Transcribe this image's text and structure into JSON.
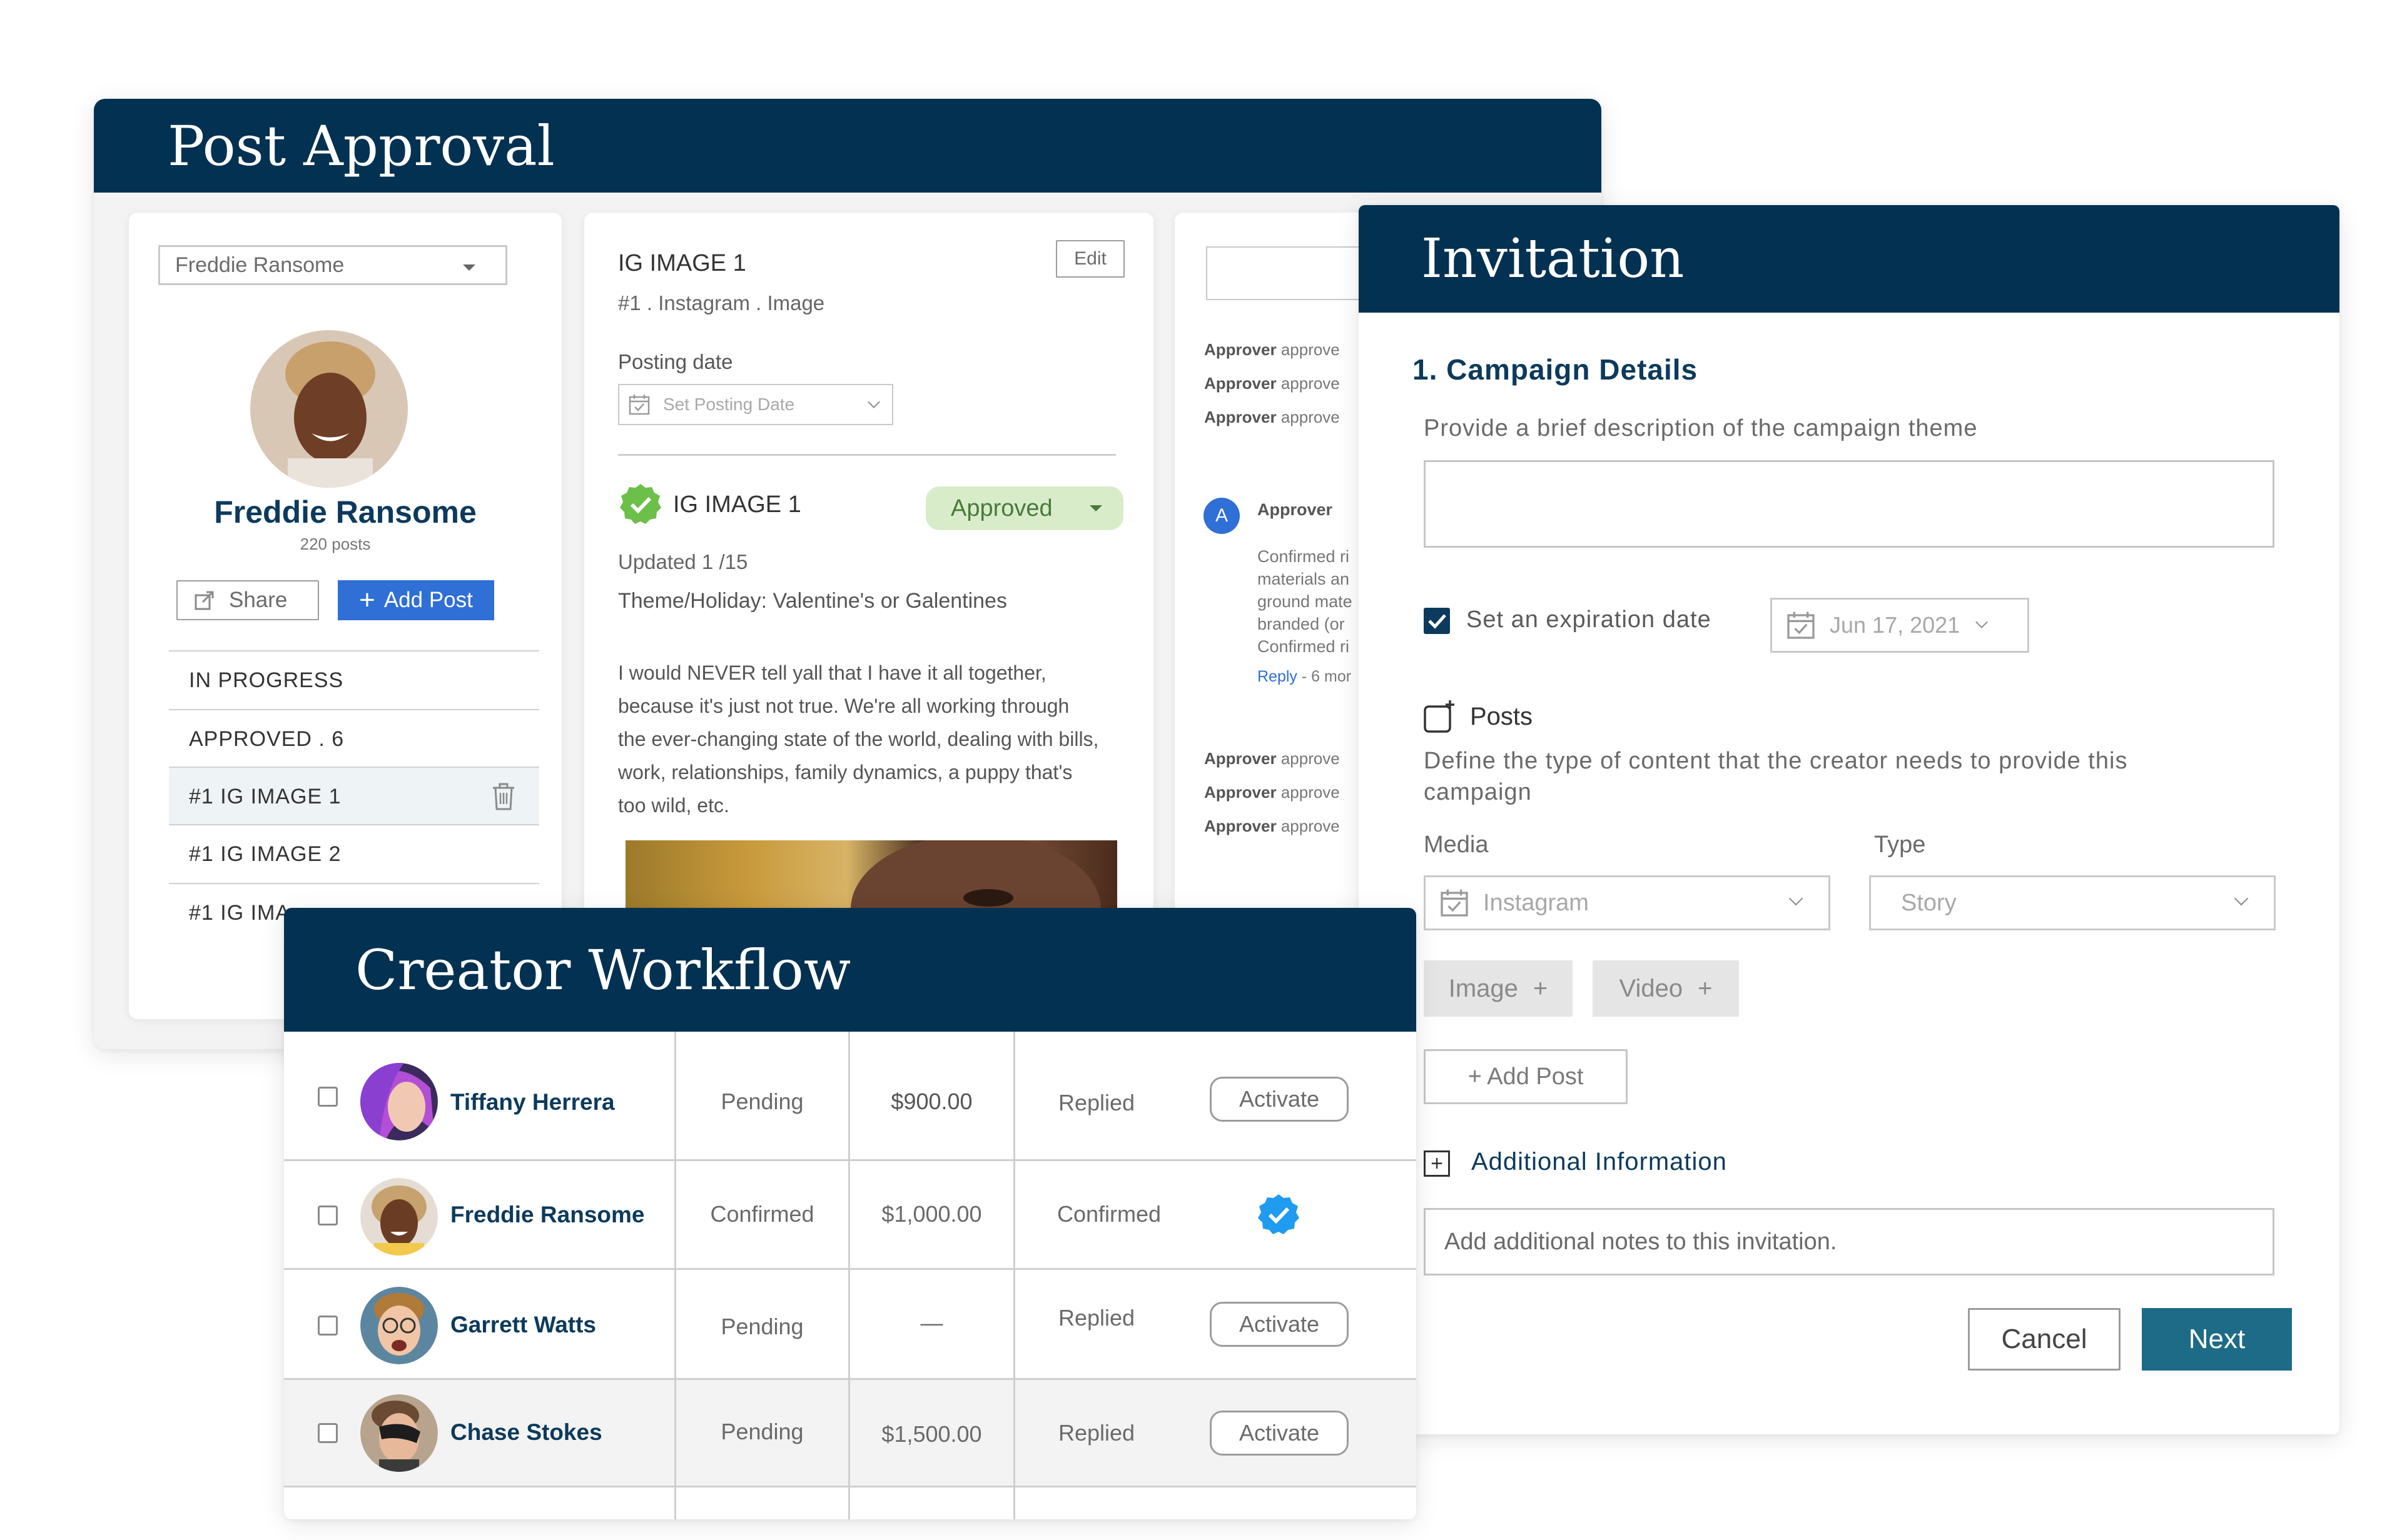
{
  "post_approval": {
    "title": "Post Approval",
    "creator_select": "Freddie Ransome",
    "profile": {
      "name": "Freddie Ransome",
      "posts": "220 posts"
    },
    "share_label": "Share",
    "add_post_label": "Add Post",
    "sections": [
      {
        "label": "IN PROGRESS"
      },
      {
        "label": "APPROVED . 6"
      },
      {
        "label": "#1 IG IMAGE 1"
      },
      {
        "label": "#1 IG IMAGE 2"
      },
      {
        "label": "#1 IG IMA"
      }
    ],
    "detail": {
      "title": "IG IMAGE 1",
      "subtitle": "#1 . Instagram . Image",
      "edit_label": "Edit",
      "posting_date_label": "Posting date",
      "posting_date_placeholder": "Set Posting Date",
      "item_title": "IG IMAGE 1",
      "status": "Approved",
      "updated": "Updated 1 /15",
      "theme": "Theme/Holiday: Valentine's or Galentines",
      "caption": "I would NEVER tell yall that I have it all together, because it's just not true. We're all working through the ever-changing state of the world, dealing with bills, work, relationships, family dynamics, a puppy that's too wild, etc."
    },
    "approvals": {
      "lines_top": [
        {
          "who": "Approver",
          "text": "approve"
        },
        {
          "who": "Approver",
          "text": "approve"
        },
        {
          "who": "Approver",
          "text": "approve"
        }
      ],
      "comment_avatar": "A",
      "comment_author": "Approver",
      "comment_lines": [
        "Confirmed ri",
        "materials an",
        "ground mate",
        "branded (or",
        "Confirmed ri"
      ],
      "reply_label": "Reply",
      "reply_time": "- 6 mor",
      "lines_bottom": [
        {
          "who": "Approver",
          "text": "approve"
        },
        {
          "who": "Approver",
          "text": "approve"
        },
        {
          "who": "Approver",
          "text": "approve"
        }
      ]
    }
  },
  "invitation": {
    "title": "Invitation",
    "section_title": "1. Campaign Details",
    "description_label": "Provide a brief description of the campaign theme",
    "expiration_label": "Set an expiration date",
    "expiration_date": "Jun 17, 2021",
    "posts_label": "Posts",
    "posts_help": "Define the type of content that the creator needs to provide this campaign",
    "media_label": "Media",
    "media_value": "Instagram",
    "type_label": "Type",
    "type_value": "Story",
    "image_btn": "Image",
    "video_btn": "Video",
    "add_post_label": "+ Add Post",
    "additional_label": "Additional Information",
    "notes_placeholder": "Add additional notes to this invitation.",
    "cancel_label": "Cancel",
    "next_label": "Next"
  },
  "workflow": {
    "title": "Creator Workflow",
    "rows": [
      {
        "name": "Tiffany Herrera",
        "status": "Pending",
        "amount": "$900.00",
        "response": "Replied",
        "action": "Activate"
      },
      {
        "name": "Freddie Ransome",
        "status": "Confirmed",
        "amount": "$1,000.00",
        "response": "Confirmed",
        "action": ""
      },
      {
        "name": "Garrett Watts",
        "status": "Pending",
        "amount": "—",
        "response": "Replied",
        "action": "Activate"
      },
      {
        "name": "Chase Stokes",
        "status": "Pending",
        "amount": "$1,500.00",
        "response": "Replied",
        "action": "Activate"
      }
    ]
  },
  "colors": {
    "header": "#033152",
    "accent_blue": "#2f6fd6",
    "next_button": "#1d6b87",
    "approved_bg": "#d8ecca",
    "verified": "#1f9bf0"
  }
}
